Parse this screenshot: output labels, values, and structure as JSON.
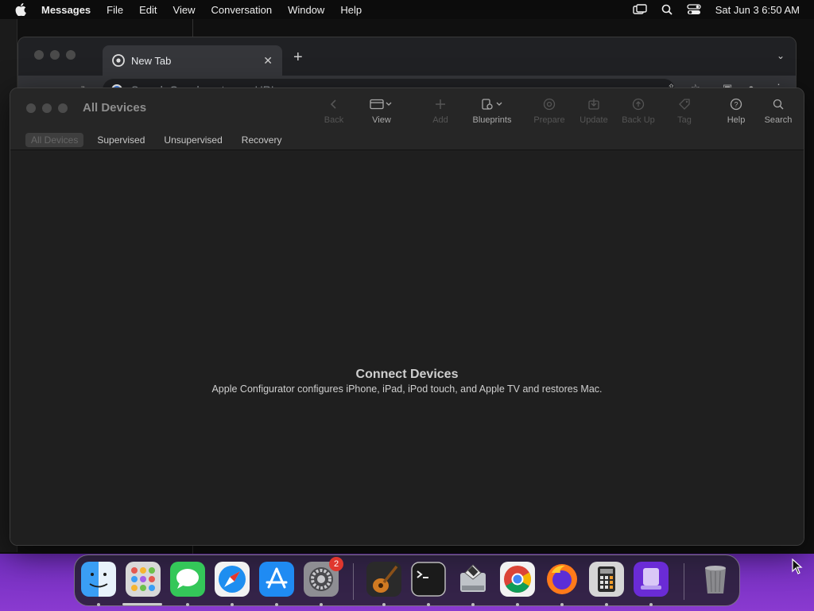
{
  "menubar": {
    "app_name": "Messages",
    "items": [
      "File",
      "Edit",
      "View",
      "Conversation",
      "Window",
      "Help"
    ],
    "clock": "Sat Jun 3  6:50 AM"
  },
  "chrome": {
    "tab_title": "New Tab",
    "omnibox_placeholder": "Search Google or type a URL"
  },
  "configurator": {
    "title": "All Devices",
    "toolbar": [
      {
        "label": "Back",
        "icon": "chevron-left-icon",
        "enabled": false
      },
      {
        "label": "View",
        "icon": "view-icon",
        "enabled": true
      },
      {
        "label": "Add",
        "icon": "plus-icon",
        "enabled": false
      },
      {
        "label": "Blueprints",
        "icon": "blueprints-icon",
        "enabled": true
      },
      {
        "label": "Prepare",
        "icon": "prepare-icon",
        "enabled": false
      },
      {
        "label": "Update",
        "icon": "update-icon",
        "enabled": false
      },
      {
        "label": "Back Up",
        "icon": "backup-icon",
        "enabled": false
      },
      {
        "label": "Tag",
        "icon": "tag-icon",
        "enabled": false
      },
      {
        "label": "Help",
        "icon": "help-icon",
        "enabled": true
      },
      {
        "label": "Search",
        "icon": "search-icon",
        "enabled": true
      }
    ],
    "filters": [
      "All Devices",
      "Supervised",
      "Unsupervised",
      "Recovery"
    ],
    "selected_filter": "All Devices",
    "empty_title": "Connect Devices",
    "empty_subtitle": "Apple Configurator configures iPhone, iPad, iPod touch, and Apple TV and restores Mac."
  },
  "dock": {
    "apps": [
      "finder-icon",
      "launchpad-icon",
      "messages-icon",
      "safari-icon",
      "app-store-icon",
      "system-settings-icon",
      "garageband-icon",
      "terminal-icon",
      "boot-camp-icon",
      "chrome-icon",
      "firefox-icon",
      "calculator-icon",
      "apple-configurator-icon",
      "trash-icon"
    ],
    "settings_badge": "2"
  }
}
